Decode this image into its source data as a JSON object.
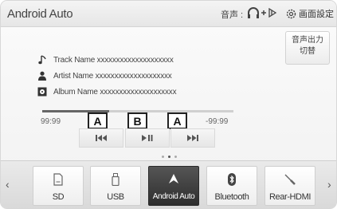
{
  "header": {
    "app_title": "Android Auto",
    "audio_label": "音声 :",
    "screen_settings_label": "画面設定"
  },
  "side_button": {
    "line1": "音声出力",
    "line2": "切替"
  },
  "track": {
    "track_name": "Track Name xxxxxxxxxxxxxxxxxxxx",
    "artist_name": "Artist Name xxxxxxxxxxxxxxxxxxxx",
    "album_name": "Album Name xxxxxxxxxxxxxxxxxxxx"
  },
  "playback": {
    "elapsed": "99:99",
    "remaining": "-99:99",
    "progress_fraction": 0.35
  },
  "callouts": {
    "left": "A",
    "middle": "B",
    "right": "A"
  },
  "controls": [
    "previous-track",
    "play-pause",
    "next-track"
  ],
  "sources": [
    {
      "label": "SD",
      "icon": "sd-card-icon",
      "active": false
    },
    {
      "label": "USB",
      "icon": "usb-icon",
      "active": false
    },
    {
      "label": "Android Auto",
      "icon": "android-auto-icon",
      "active": true
    },
    {
      "label": "Bluetooth",
      "icon": "bluetooth-icon",
      "active": false
    },
    {
      "label": "Rear-HDMI",
      "icon": "rear-hdmi-icon",
      "active": false
    }
  ],
  "tray_arrows": {
    "left": "‹",
    "right": "›"
  },
  "colors": {
    "active_source_bg": "#3a3a3a",
    "progress_fill": "#666666",
    "progress_track": "#d0d0d0"
  }
}
